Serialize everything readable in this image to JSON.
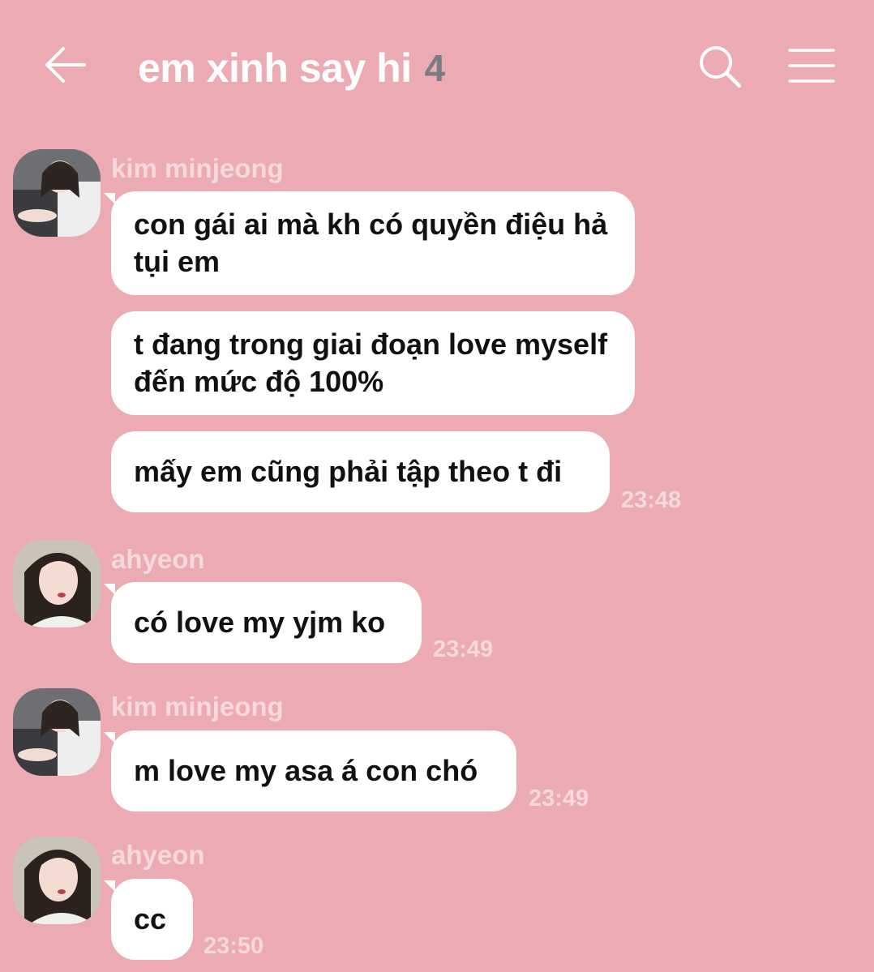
{
  "header": {
    "title": "em xinh say hi",
    "member_count": "4"
  },
  "messages": [
    {
      "sender": "kim minjeong",
      "bubbles": [
        "con gái ai mà kh có quyền điệu hả tụi em",
        "t đang trong giai đoạn love myself đến mức độ 100%",
        "mấy em cũng phải tập theo t đi"
      ],
      "time": "23:48"
    },
    {
      "sender": "ahyeon",
      "bubbles": [
        "có love my yjm ko"
      ],
      "time": "23:49"
    },
    {
      "sender": "kim minjeong",
      "bubbles": [
        "m love my asa á con chó"
      ],
      "time": "23:49"
    },
    {
      "sender": "ahyeon",
      "bubbles": [
        "cc"
      ],
      "time": "23:50"
    }
  ],
  "colors": {
    "background": "#ecabb3",
    "bubble": "#ffffff",
    "meta_text": "#f6d9dd",
    "member_count": "#7a7d84"
  },
  "icons": [
    "back-arrow-icon",
    "search-icon",
    "menu-icon"
  ]
}
